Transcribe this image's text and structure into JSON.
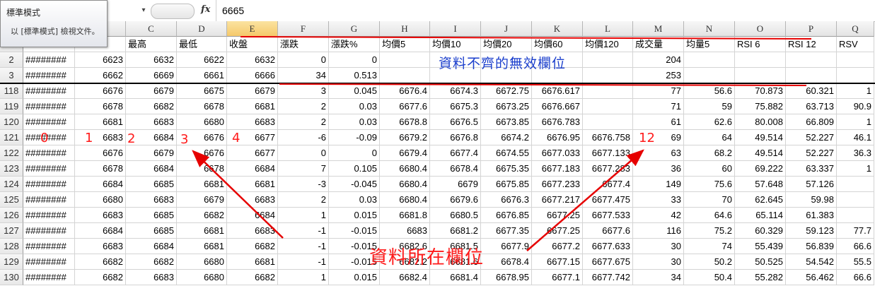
{
  "formula_bar": {
    "value": "6665",
    "fx_label": "fx",
    "dropdown_glyph": "▾"
  },
  "tooltip": {
    "title": "標準模式",
    "description": "以 [標準模式] 檢視文件。"
  },
  "columns": [
    "",
    "",
    "C",
    "D",
    "E",
    "F",
    "G",
    "H",
    "I",
    "J",
    "K",
    "L",
    "M",
    "N",
    "O",
    "P",
    "Q"
  ],
  "selected_column": "E",
  "header_labels": [
    "",
    "",
    "最高",
    "最低",
    "收盤",
    "漲跌",
    "漲跌%",
    "均價5",
    "均價10",
    "均價20",
    "均價60",
    "均價120",
    "成交量",
    "均量5",
    "RSI 6",
    "RSI 12",
    "RSV"
  ],
  "rows": [
    {
      "n": "2",
      "cells": [
        "########",
        "6623",
        "6632",
        "6622",
        "6632",
        "0",
        "0",
        "",
        "",
        "",
        "",
        "",
        "204",
        "",
        "",
        "",
        ""
      ]
    },
    {
      "n": "3",
      "cells": [
        "########",
        "6662",
        "6669",
        "6661",
        "6666",
        "34",
        "0.513",
        "",
        "",
        "",
        "",
        "",
        "253",
        "",
        "",
        "",
        ""
      ]
    },
    {
      "n": "118",
      "cells": [
        "########",
        "6676",
        "6679",
        "6675",
        "6679",
        "3",
        "0.045",
        "6676.4",
        "6674.3",
        "6672.75",
        "6676.617",
        "",
        "77",
        "56.6",
        "70.873",
        "60.321",
        "1"
      ]
    },
    {
      "n": "119",
      "cells": [
        "########",
        "6678",
        "6682",
        "6678",
        "6681",
        "2",
        "0.03",
        "6677.6",
        "6675.3",
        "6673.25",
        "6676.667",
        "",
        "71",
        "59",
        "75.882",
        "63.713",
        "90.9"
      ]
    },
    {
      "n": "120",
      "cells": [
        "########",
        "6681",
        "6683",
        "6680",
        "6683",
        "2",
        "0.03",
        "6678.8",
        "6676.5",
        "6673.85",
        "6676.783",
        "",
        "61",
        "62.6",
        "80.008",
        "66.809",
        "1"
      ]
    },
    {
      "n": "121",
      "cells": [
        "########",
        "6683",
        "6684",
        "6676",
        "6677",
        "-6",
        "-0.09",
        "6679.2",
        "6676.8",
        "6674.2",
        "6676.95",
        "6676.758",
        "69",
        "64",
        "49.514",
        "52.227",
        "46.1"
      ]
    },
    {
      "n": "122",
      "cells": [
        "########",
        "6676",
        "6679",
        "6676",
        "6677",
        "0",
        "0",
        "6679.4",
        "6677.4",
        "6674.55",
        "6677.033",
        "6677.133",
        "63",
        "68.2",
        "49.514",
        "52.227",
        "36.3"
      ]
    },
    {
      "n": "123",
      "cells": [
        "########",
        "6678",
        "6684",
        "6678",
        "6684",
        "7",
        "0.105",
        "6680.4",
        "6678.4",
        "6675.35",
        "6677.183",
        "6677.283",
        "36",
        "60",
        "69.222",
        "63.337",
        "1"
      ]
    },
    {
      "n": "124",
      "cells": [
        "########",
        "6684",
        "6685",
        "6681",
        "6681",
        "-3",
        "-0.045",
        "6680.4",
        "6679",
        "6675.85",
        "6677.233",
        "6677.4",
        "149",
        "75.6",
        "57.648",
        "57.126",
        ""
      ]
    },
    {
      "n": "125",
      "cells": [
        "########",
        "6680",
        "6683",
        "6679",
        "6683",
        "2",
        "0.03",
        "6680.4",
        "6679.6",
        "6676.3",
        "6677.217",
        "6677.475",
        "33",
        "70",
        "62.645",
        "59.98",
        ""
      ]
    },
    {
      "n": "126",
      "cells": [
        "########",
        "6683",
        "6685",
        "6682",
        "6684",
        "1",
        "0.015",
        "6681.8",
        "6680.5",
        "6676.85",
        "6677.25",
        "6677.533",
        "42",
        "64.6",
        "65.114",
        "61.383",
        ""
      ]
    },
    {
      "n": "127",
      "cells": [
        "########",
        "6684",
        "6685",
        "6681",
        "6683",
        "-1",
        "-0.015",
        "6683",
        "6681.2",
        "6677.35",
        "6677.25",
        "6677.6",
        "116",
        "75.2",
        "60.329",
        "59.123",
        "77.7"
      ]
    },
    {
      "n": "128",
      "cells": [
        "########",
        "6683",
        "6684",
        "6681",
        "6682",
        "-1",
        "-0.015",
        "6682.6",
        "6681.5",
        "6677.9",
        "6677.2",
        "6677.633",
        "30",
        "74",
        "55.439",
        "56.839",
        "66.6"
      ]
    },
    {
      "n": "129",
      "cells": [
        "########",
        "6682",
        "6682",
        "6680",
        "6681",
        "-1",
        "-0.015",
        "6682.2",
        "6681.6",
        "6678.4",
        "6677.15",
        "6677.675",
        "30",
        "50.2",
        "50.525",
        "54.542",
        "55.5"
      ]
    },
    {
      "n": "130",
      "cells": [
        "########",
        "6682",
        "6683",
        "6680",
        "6682",
        "1",
        "0.015",
        "6682.4",
        "6681.4",
        "6678.95",
        "6677.1",
        "6677.742",
        "34",
        "50.4",
        "55.282",
        "56.462",
        "66.6"
      ]
    }
  ],
  "annotations": {
    "invalid_note": "資料不齊的無效欄位",
    "valid_note": "資料所在欄位",
    "index_labels": [
      "0",
      "1",
      "2",
      "3",
      "4",
      "12"
    ],
    "annotation_color": "#ff1a1a",
    "invalid_note_color": "#1a3ecc",
    "selected_header_color": "#f5c96b"
  }
}
